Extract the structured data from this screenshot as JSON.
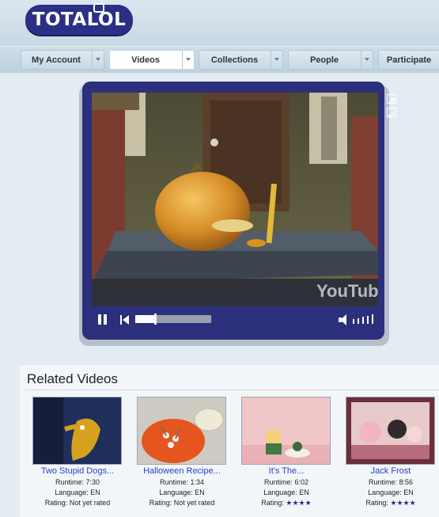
{
  "brand": {
    "logo_text": "TOTALOL"
  },
  "nav": {
    "items": [
      {
        "label": "My Account"
      },
      {
        "label": "Videos"
      },
      {
        "label": "Collections"
      },
      {
        "label": "People"
      },
      {
        "label": "Participate"
      }
    ],
    "active": "Videos"
  },
  "player": {
    "watermark": "YouTube",
    "progress_fraction": 0.25,
    "volume_bars": 5
  },
  "related": {
    "title": "Related Videos",
    "runtime_label": "Runtime:",
    "language_label": "Language:",
    "rating_label": "Rating:",
    "videos": [
      {
        "title": "Two Stupid Dogs...",
        "runtime": "7:30",
        "language": "EN",
        "rating": "Not yet rated"
      },
      {
        "title": "Halloween Recipe...",
        "runtime": "1:34",
        "language": "EN",
        "rating": "Not yet rated"
      },
      {
        "title": "It's The...",
        "runtime": "6:02",
        "language": "EN",
        "rating": "★★★★"
      },
      {
        "title": "Jack Frost",
        "runtime": "8:56",
        "language": "EN",
        "rating": "★★★★"
      }
    ]
  },
  "colors": {
    "brand_navy": "#2c2f7b",
    "link_blue": "#2a43c4",
    "page_bg": "#e3ecf3"
  }
}
